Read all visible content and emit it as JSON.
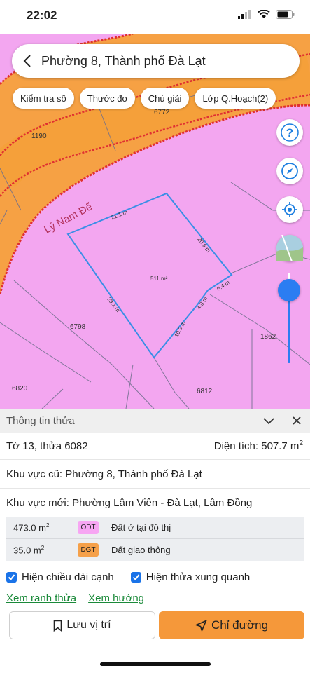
{
  "status": {
    "time": "22:02"
  },
  "header": {
    "title": "Phường 8, Thành phố Đà Lạt"
  },
  "chips": [
    "Kiểm tra số",
    "Thước đo",
    "Chú giải",
    "Lớp Q.Hoạch(2)"
  ],
  "map": {
    "labels": {
      "p6772": "6772",
      "p1190": "1190",
      "p6798": "6798",
      "p1862": "1862",
      "p6820": "6820",
      "p6812": "6812",
      "area": "511 m²",
      "road": "Lý Nam Đế"
    },
    "edges": [
      "21.1 m",
      "20.6 m",
      "6.4 m",
      "4.8 m",
      "10.9 m",
      "29.1 m"
    ]
  },
  "panel": {
    "title": "Thông tin thửa",
    "parcel": "Tờ 13, thửa 6082",
    "area_label": "Diện tích: 507.7 m",
    "area_sup": "2",
    "old_region": "Khu vực cũ: Phường 8, Thành phố Đà Lạt",
    "new_region": "Khu vực mới: Phường Lâm Viên - Đà Lạt, Lâm Đồng",
    "land": [
      {
        "area": "473.0 m",
        "sup": "2",
        "code": "ODT",
        "desc": "Đất ở tại đô thị",
        "color": "#f7a6f3"
      },
      {
        "area": "35.0 m",
        "sup": "2",
        "code": "DGT",
        "desc": "Đất giao thông",
        "color": "#f5a04a"
      }
    ],
    "check_edges": "Hiện chiều dài cạnh",
    "check_neighbors": "Hiện thửa xung quanh",
    "link_boundary": "Xem ranh thửa",
    "link_direction": "Xem hướng",
    "btn_save": "Lưu vị trí",
    "btn_directions": "Chỉ đường"
  }
}
